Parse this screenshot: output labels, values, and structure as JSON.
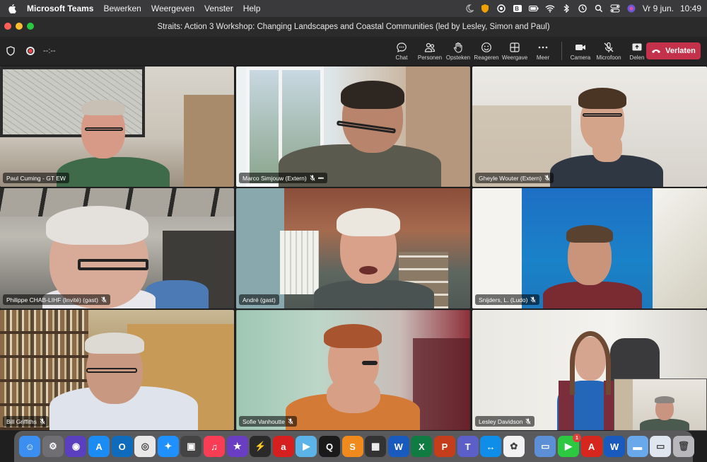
{
  "menubar": {
    "app_name": "Microsoft Teams",
    "menus": [
      "Bewerken",
      "Weergeven",
      "Venster",
      "Help"
    ],
    "clock_date": "Vr 9 jun.",
    "clock_time": "10:49"
  },
  "window": {
    "title": "Straits: Action 3 Workshop: Changing Landscapes and Coastal Communities (led by Lesley, Simon and Paul)"
  },
  "toolbar": {
    "timer": "--:--",
    "controls": {
      "chat": "Chat",
      "people": "Personen",
      "raise": "Opsteken",
      "react": "Reageren",
      "view": "Weergave",
      "more": "Meer",
      "camera": "Camera",
      "mic": "Microfoon",
      "share": "Delen"
    },
    "leave_label": "Verlaten",
    "leave_color": "#c4314b"
  },
  "participants": [
    {
      "name": "Paul Cuming - GT EW",
      "muted": false,
      "icon": "none"
    },
    {
      "name": "Marco Simjouw (Extern)",
      "muted": true,
      "icon": "mic-off-icon"
    },
    {
      "name": "Gheyle Wouter (Extern)",
      "muted": true,
      "icon": "mic-off-icon"
    },
    {
      "name": "Philippe CHAB-LIHF (Invité) (gast)",
      "muted": true,
      "icon": "mic-off-icon"
    },
    {
      "name": "André (gast)",
      "muted": false,
      "icon": "none",
      "active_speaker": true
    },
    {
      "name": "Snijders, L. (Ludo)",
      "muted": true,
      "icon": "mic-off-icon"
    },
    {
      "name": "Bill Griffiths",
      "muted": true,
      "icon": "mic-off-icon"
    },
    {
      "name": "Sofie Vanhoutte",
      "muted": true,
      "icon": "mic-off-icon"
    },
    {
      "name": "Lesley Davidson",
      "muted": true,
      "icon": "mic-off-icon"
    }
  ],
  "dock": {
    "apps": [
      {
        "name": "finder-icon",
        "glyph": "☺",
        "color": "#3b8ff0"
      },
      {
        "name": "system-settings-icon",
        "glyph": "⚙",
        "color": "#6e6e73"
      },
      {
        "name": "siri-icon",
        "glyph": "◉",
        "color": "#5a3fbf"
      },
      {
        "name": "app-store-icon",
        "glyph": "A",
        "color": "#1c8cf5"
      },
      {
        "name": "outlook-icon",
        "glyph": "O",
        "color": "#0f6cbd"
      },
      {
        "name": "chrome-icon",
        "glyph": "◎",
        "color": "#e8e8e8"
      },
      {
        "name": "safari-icon",
        "glyph": "✦",
        "color": "#1e90ff"
      },
      {
        "name": "screenshot-icon",
        "glyph": "▣",
        "color": "#444"
      },
      {
        "name": "music-icon",
        "glyph": "♫",
        "color": "#f93d55"
      },
      {
        "name": "imovie-icon",
        "glyph": "★",
        "color": "#6a3ec2"
      },
      {
        "name": "spotlight-app-icon",
        "glyph": "⚡",
        "color": "#2a2a2a"
      },
      {
        "name": "a-app-icon",
        "glyph": "a",
        "color": "#d62020"
      },
      {
        "name": "mp4-icon",
        "glyph": "▶",
        "color": "#5bb3e8"
      },
      {
        "name": "quicktime-icon",
        "glyph": "Q",
        "color": "#1a1a1a"
      },
      {
        "name": "studio-icon",
        "glyph": "S",
        "color": "#f08a1c"
      },
      {
        "name": "calculator-icon",
        "glyph": "▦",
        "color": "#333"
      },
      {
        "name": "word-icon",
        "glyph": "W",
        "color": "#185abd"
      },
      {
        "name": "excel-icon",
        "glyph": "X",
        "color": "#107c41"
      },
      {
        "name": "powerpoint-icon",
        "glyph": "P",
        "color": "#c43e1c"
      },
      {
        "name": "teams-icon",
        "glyph": "T",
        "color": "#5b5fc7"
      },
      {
        "name": "teamviewer-icon",
        "glyph": "↔",
        "color": "#0e8ee9"
      },
      {
        "name": "photos-icon",
        "glyph": "✿",
        "color": "#f2f2f2"
      }
    ],
    "apps_right": [
      {
        "name": "preview-icon",
        "glyph": "▭",
        "color": "#5c8fd6"
      },
      {
        "name": "facetime-icon",
        "glyph": "▶",
        "color": "#2bc840",
        "badge": "1"
      },
      {
        "name": "acrobat-icon",
        "glyph": "A",
        "color": "#d7261e"
      },
      {
        "name": "word-doc-icon",
        "glyph": "W",
        "color": "#185abd"
      },
      {
        "name": "folder-icon",
        "glyph": "▬",
        "color": "#6aa8ec"
      },
      {
        "name": "screen-icon",
        "glyph": "▭",
        "color": "#dfe6f0"
      },
      {
        "name": "trash-icon",
        "glyph": "🗑",
        "color": "#b8b8bc"
      }
    ]
  }
}
